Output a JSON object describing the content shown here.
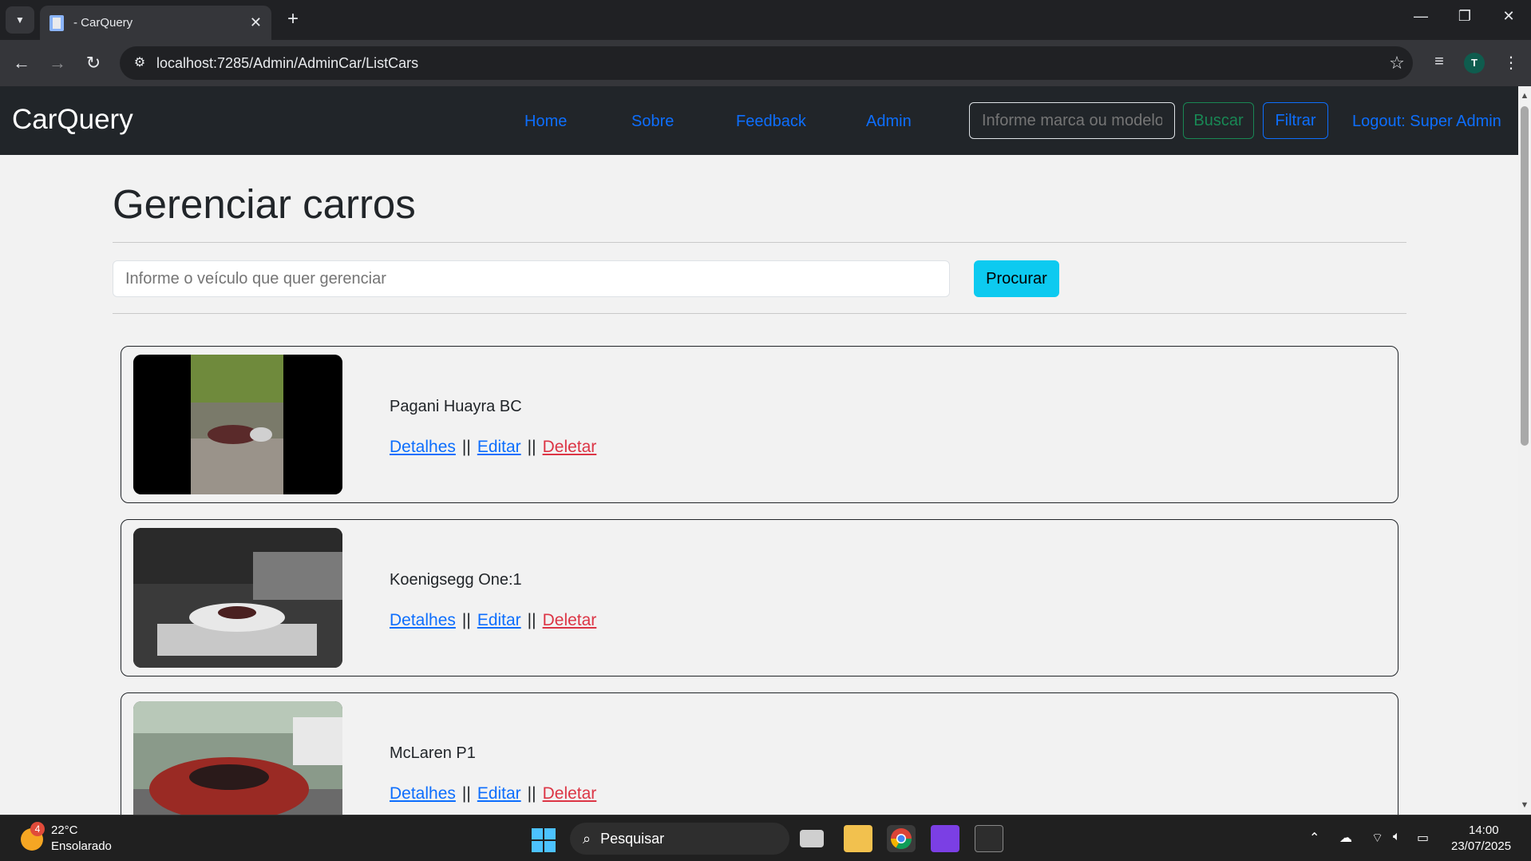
{
  "browser": {
    "tab_title": "- CarQuery",
    "url": "localhost:7285/Admin/AdminCar/ListCars",
    "profile_initial": "T"
  },
  "navbar": {
    "brand": "CarQuery",
    "links": [
      "Home",
      "Sobre",
      "Feedback",
      "Admin"
    ],
    "search_placeholder": "Informe marca ou modelo",
    "search_button": "Buscar",
    "filter_button": "Filtrar",
    "logout": "Logout: Super Admin"
  },
  "main": {
    "title": "Gerenciar carros",
    "search_placeholder": "Informe o veículo que quer gerenciar",
    "search_button": "Procurar",
    "action_labels": {
      "details": "Detalhes",
      "edit": "Editar",
      "delete": "Deletar",
      "separator": "||"
    },
    "cars": [
      {
        "name": "Pagani Huayra BC"
      },
      {
        "name": "Koenigsegg One:1"
      },
      {
        "name": "McLaren P1"
      }
    ]
  },
  "taskbar": {
    "weather_badge": "4",
    "weather_temp": "22°C",
    "weather_desc": "Ensolarado",
    "search_label": "Pesquisar",
    "time": "14:00",
    "date": "23/07/2025"
  },
  "colors": {
    "navbar_bg": "#212529",
    "link_primary": "#0d6efd",
    "link_danger": "#dc3545",
    "btn_info": "#0dcaf0",
    "btn_success": "#198754"
  }
}
